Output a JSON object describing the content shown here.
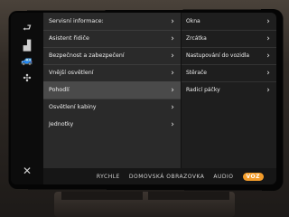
{
  "left_bar": {
    "icons": [
      {
        "name": "back-icon",
        "glyph": "⮐"
      },
      {
        "name": "seat-icon",
        "glyph": "▟"
      },
      {
        "name": "vehicle-icon",
        "glyph": "🚙"
      },
      {
        "name": "fan-icon",
        "glyph": "✣"
      },
      {
        "name": "close-icon",
        "glyph": "✕"
      }
    ],
    "active_color": "#f39c2a"
  },
  "menu": {
    "items": [
      {
        "label": "Servisní informace:"
      },
      {
        "label": "Asistent řidiče"
      },
      {
        "label": "Bezpečnost a zabezpečení"
      },
      {
        "label": "Vnější osvětlení"
      },
      {
        "label": "Pohodlí",
        "selected": true
      },
      {
        "label": "Osvětlení kabiny"
      },
      {
        "label": "Jednotky"
      }
    ]
  },
  "submenu": {
    "items": [
      {
        "label": "Okna"
      },
      {
        "label": "Zrcátka"
      },
      {
        "label": "Nastupování do vozidla"
      },
      {
        "label": "Stěrače"
      },
      {
        "label": "Řadicí páčky"
      }
    ]
  },
  "bottom_tabs": [
    {
      "label": "RYCHLE"
    },
    {
      "label": "DOMOVSKÁ OBRAZOVKA"
    },
    {
      "label": "AUDIO"
    },
    {
      "label": "VOZ",
      "active": true
    }
  ],
  "colors": {
    "accent": "#f39c2a",
    "selected_row": "#4a4a4a"
  }
}
